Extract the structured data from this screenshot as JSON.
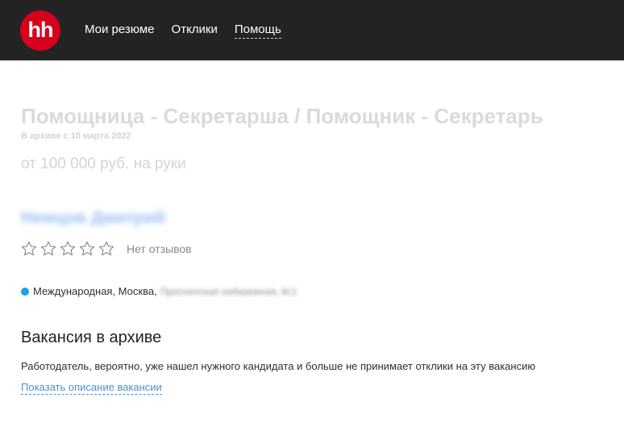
{
  "header": {
    "logo_text": "hh",
    "brand_color": "#d6001c",
    "nav": [
      {
        "label": "Мои резюме"
      },
      {
        "label": "Отклики"
      },
      {
        "label": "Помощь"
      }
    ]
  },
  "vacancy": {
    "title": "Помощница - Секретарша / Помощник - Секретарь",
    "archived_date": "В архиве с 10 марта 2022",
    "salary": "от 100 000 руб. на руки",
    "company": "Немцов Дмитрий",
    "rating": {
      "stars": 0,
      "max_stars": 5,
      "reviews_label": "Нет отзывов"
    },
    "address": {
      "metro_color": "#1aa3e8",
      "metro": "Международная, Москва,",
      "street_blurred": "Пресненская набережная, 8с1"
    },
    "archive_section": {
      "title": "Вакансия в архиве",
      "notice": "Работодатель, вероятно, уже нашел нужного кандидата и больше не принимает отклики на эту вакансию",
      "show_description_link": "Показать описание вакансии"
    }
  }
}
